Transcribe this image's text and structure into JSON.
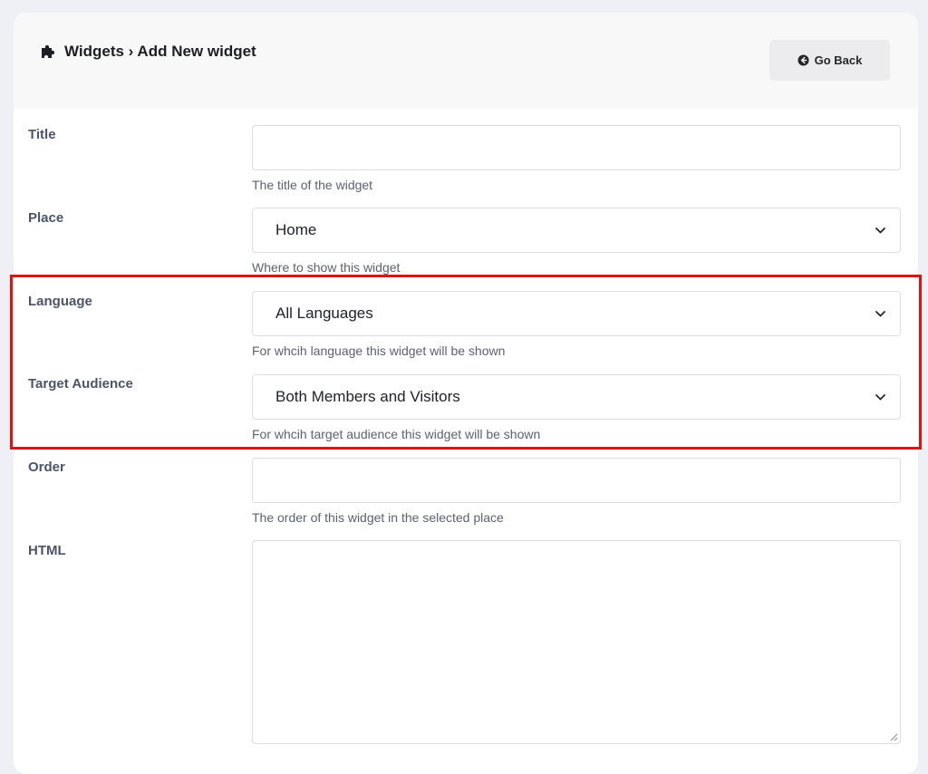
{
  "header": {
    "breadcrumb": "Widgets › Add New widget",
    "go_back_label": "Go Back"
  },
  "form": {
    "title": {
      "label": "Title",
      "value": "",
      "help": "The title of the widget"
    },
    "place": {
      "label": "Place",
      "selected": "Home",
      "help": "Where to show this widget"
    },
    "language": {
      "label": "Language",
      "selected": "All Languages",
      "help": "For whcih language this widget will be shown"
    },
    "target_audience": {
      "label": "Target Audience",
      "selected": "Both Members and Visitors",
      "help": "For whcih target audience this widget will be shown"
    },
    "order": {
      "label": "Order",
      "value": "",
      "help": "The order of this widget in the selected place"
    },
    "html": {
      "label": "HTML",
      "value": ""
    }
  },
  "colors": {
    "highlight": "#e01313",
    "background": "#eef0f5",
    "label": "#4b5468"
  },
  "icons": {
    "header": "puzzle-piece-icon",
    "go_back": "arrow-circle-left-icon",
    "select": "chevron-down-icon"
  }
}
